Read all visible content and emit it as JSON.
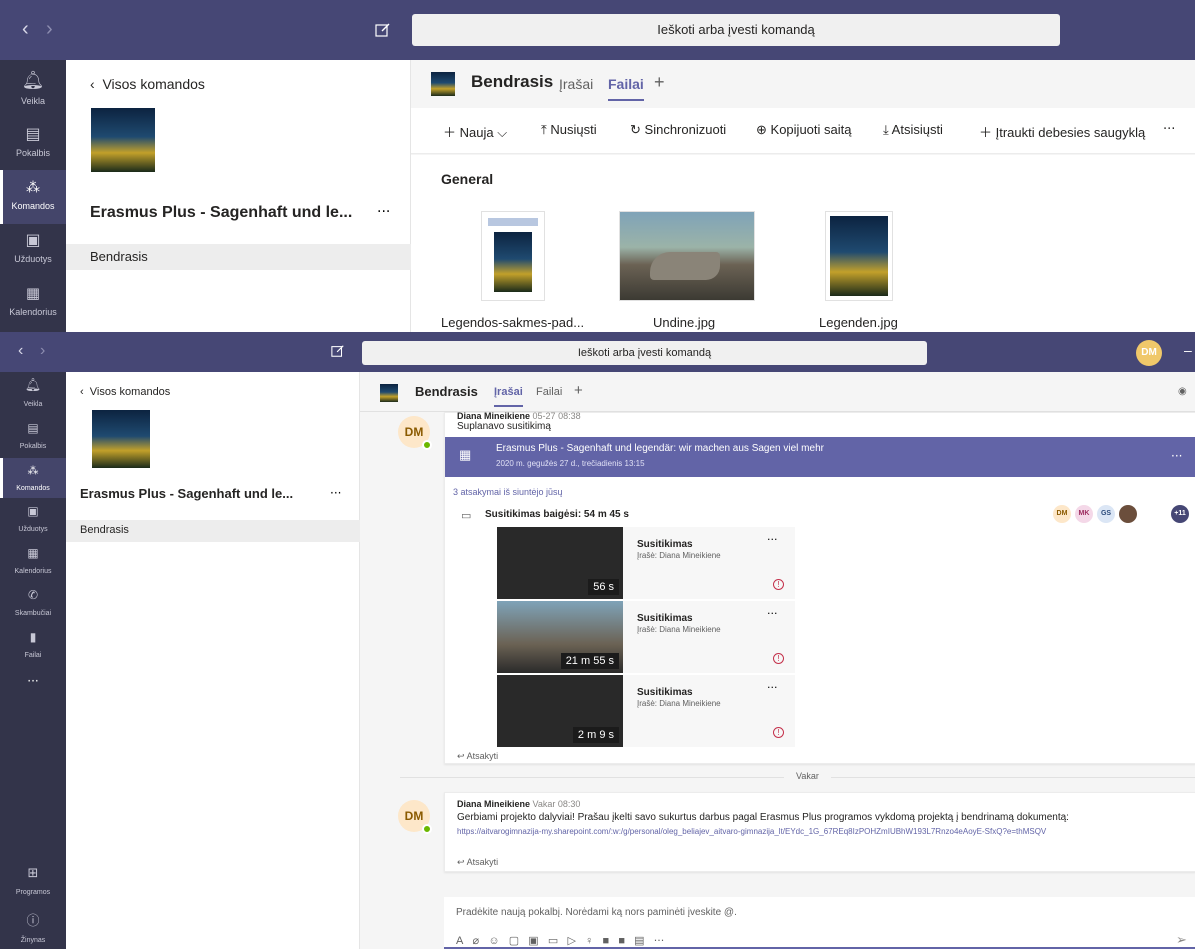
{
  "top": {
    "nav_back": "‹",
    "nav_forward": "›",
    "search_text": "Ieškoti arba įvesti komandą",
    "rail": [
      {
        "label": "Veikla"
      },
      {
        "label": "Pokalbis"
      },
      {
        "label": "Komandos"
      },
      {
        "label": "Užduotys"
      },
      {
        "label": "Kalendorius"
      }
    ],
    "back_link": "Visos komandos",
    "team_name": "Erasmus Plus - Sagenhaft und le...",
    "channel": "Bendrasis",
    "header": {
      "channel": "Bendrasis",
      "tab_posts": "Įrašai",
      "tab_files": "Failai",
      "add": "+"
    },
    "toolbar": {
      "new": "Nauja",
      "upload": "Nusiųsti",
      "sync": "Sinchronizuoti",
      "copy_link": "Kopijuoti saitą",
      "download": "Atsisiųsti",
      "add_cloud": "Įtraukti debesies saugyklą",
      "more": "···"
    },
    "section": "General",
    "files": [
      {
        "name": "Legendos-sakmes-pad..."
      },
      {
        "name": "Undine.jpg"
      },
      {
        "name": "Legenden.jpg"
      }
    ]
  },
  "bottom": {
    "nav_back": "‹",
    "nav_forward": "›",
    "search_text": "Ieškoti arba įvesti komandą",
    "user_initials": "DM",
    "rail": [
      {
        "label": "Veikla"
      },
      {
        "label": "Pokalbis"
      },
      {
        "label": "Komandos"
      },
      {
        "label": "Užduotys"
      },
      {
        "label": "Kalendorius"
      },
      {
        "label": "Skambučiai"
      },
      {
        "label": "Failai"
      },
      {
        "label": "···"
      },
      {
        "label": "Programos"
      },
      {
        "label": "Žinynas"
      }
    ],
    "back_link": "Visos komandos",
    "team_name": "Erasmus Plus - Sagenhaft und le...",
    "channel": "Bendrasis",
    "header": {
      "channel": "Bendrasis",
      "tab_posts": "Įrašai",
      "tab_files": "Failai",
      "add": "+"
    },
    "msg1": {
      "author": "Diana Mineikiene",
      "time": "05-27 08:38",
      "text": "Suplanavo susitikimą",
      "meeting_title": "Erasmus Plus - Sagenhaft und legendär: wir machen aus Sagen viel mehr",
      "meeting_date": "2020 m. gegužės 27 d., trečiadienis 13:15",
      "replies": "3 atsakymai iš siuntėjo jūsų",
      "ended": "Susitikimas baigėsi: 54 m 45 s",
      "participants": [
        "DM",
        "MK",
        "GS",
        "+11"
      ],
      "recordings": [
        {
          "title": "Susitikimas",
          "by": "Įrašė: Diana Mineikiene",
          "duration": "56 s"
        },
        {
          "title": "Susitikimas",
          "by": "Įrašė: Diana Mineikiene",
          "duration": "21 m 55 s"
        },
        {
          "title": "Susitikimas",
          "by": "Įrašė: Diana Mineikiene",
          "duration": "2 m 9 s"
        }
      ],
      "reply": "Atsakyti"
    },
    "divider": "Vakar",
    "msg2": {
      "author": "Diana Mineikiene",
      "time": "Vakar 08:30",
      "text": "Gerbiami projekto dalyviai! Prašau įkelti savo sukurtus darbus pagal Erasmus Plus programos vykdomą projektą į bendrinamą dokumentą:",
      "link": "https://aitvarogimnazija-my.sharepoint.com/:w:/g/personal/oleg_beliajev_aitvaro-gimnazija_lt/EYdc_1G_67REq8IzPOHZmIUBhW193L7Rnzo4eAoyE-SfxQ?e=thMSQV",
      "reply": "Atsakyti"
    },
    "composer_placeholder": "Pradėkite naują pokalbį. Norėdami ką nors paminėti įveskite @."
  }
}
